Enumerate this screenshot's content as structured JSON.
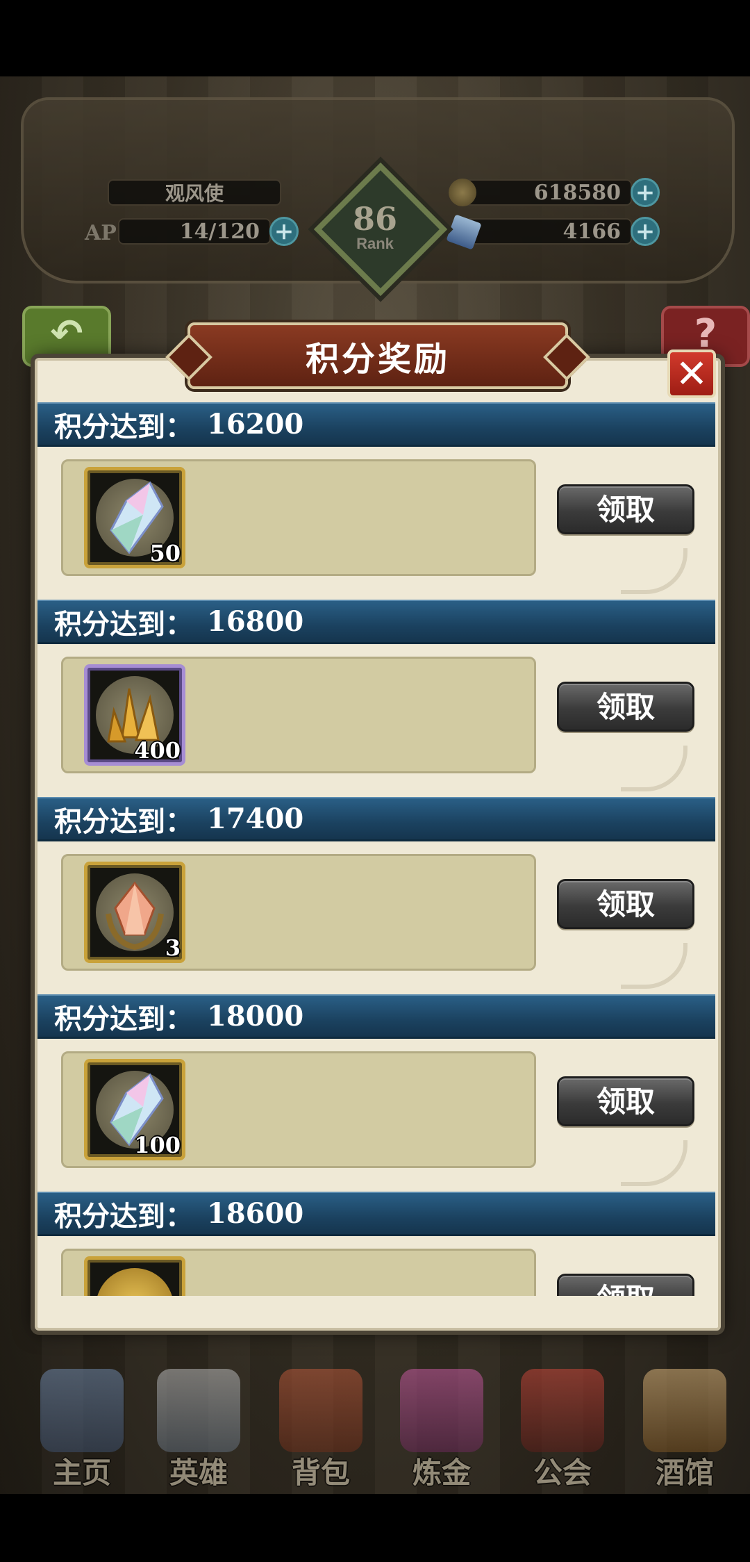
{
  "header": {
    "player_name": "观风使",
    "ap_label": "AP",
    "ap_value": "14/120",
    "gold": "618580",
    "gems": "4166",
    "rank_value": "86",
    "rank_label": "Rank"
  },
  "dialog": {
    "title": "积分奖励",
    "close_label": "✕",
    "rows": [
      {
        "label": "积分达到：",
        "score": "16200",
        "item_count": "50",
        "item_icon": "rainbow-crystal-icon",
        "claim_label": "领取"
      },
      {
        "label": "积分达到：",
        "score": "16800",
        "item_count": "400",
        "item_icon": "gold-crystal-cluster-icon",
        "claim_label": "领取"
      },
      {
        "label": "积分达到：",
        "score": "17400",
        "item_count": "3",
        "item_icon": "orange-gem-laurel-icon",
        "claim_label": "领取"
      },
      {
        "label": "积分达到：",
        "score": "18000",
        "item_count": "100",
        "item_icon": "rainbow-crystal-icon",
        "claim_label": "领取"
      },
      {
        "label": "积分达到：",
        "score": "18600",
        "item_count": "",
        "item_icon": "gold-coin-icon",
        "claim_label": "领取"
      }
    ]
  },
  "nav": {
    "items": [
      {
        "label": "主页",
        "icon": "castle-icon"
      },
      {
        "label": "英雄",
        "icon": "hero-helmet-icon"
      },
      {
        "label": "背包",
        "icon": "backpack-icon"
      },
      {
        "label": "炼金",
        "icon": "alchemy-flask-icon"
      },
      {
        "label": "公会",
        "icon": "guild-shield-icon"
      },
      {
        "label": "酒馆",
        "icon": "tavern-mug-icon"
      }
    ]
  },
  "colors": {
    "row_header": "#1b4260",
    "claim_button": "#3b3b3b",
    "close_button": "#c0301f",
    "title_banner": "#7a2e1a",
    "panel_bg": "#efe9d6"
  }
}
